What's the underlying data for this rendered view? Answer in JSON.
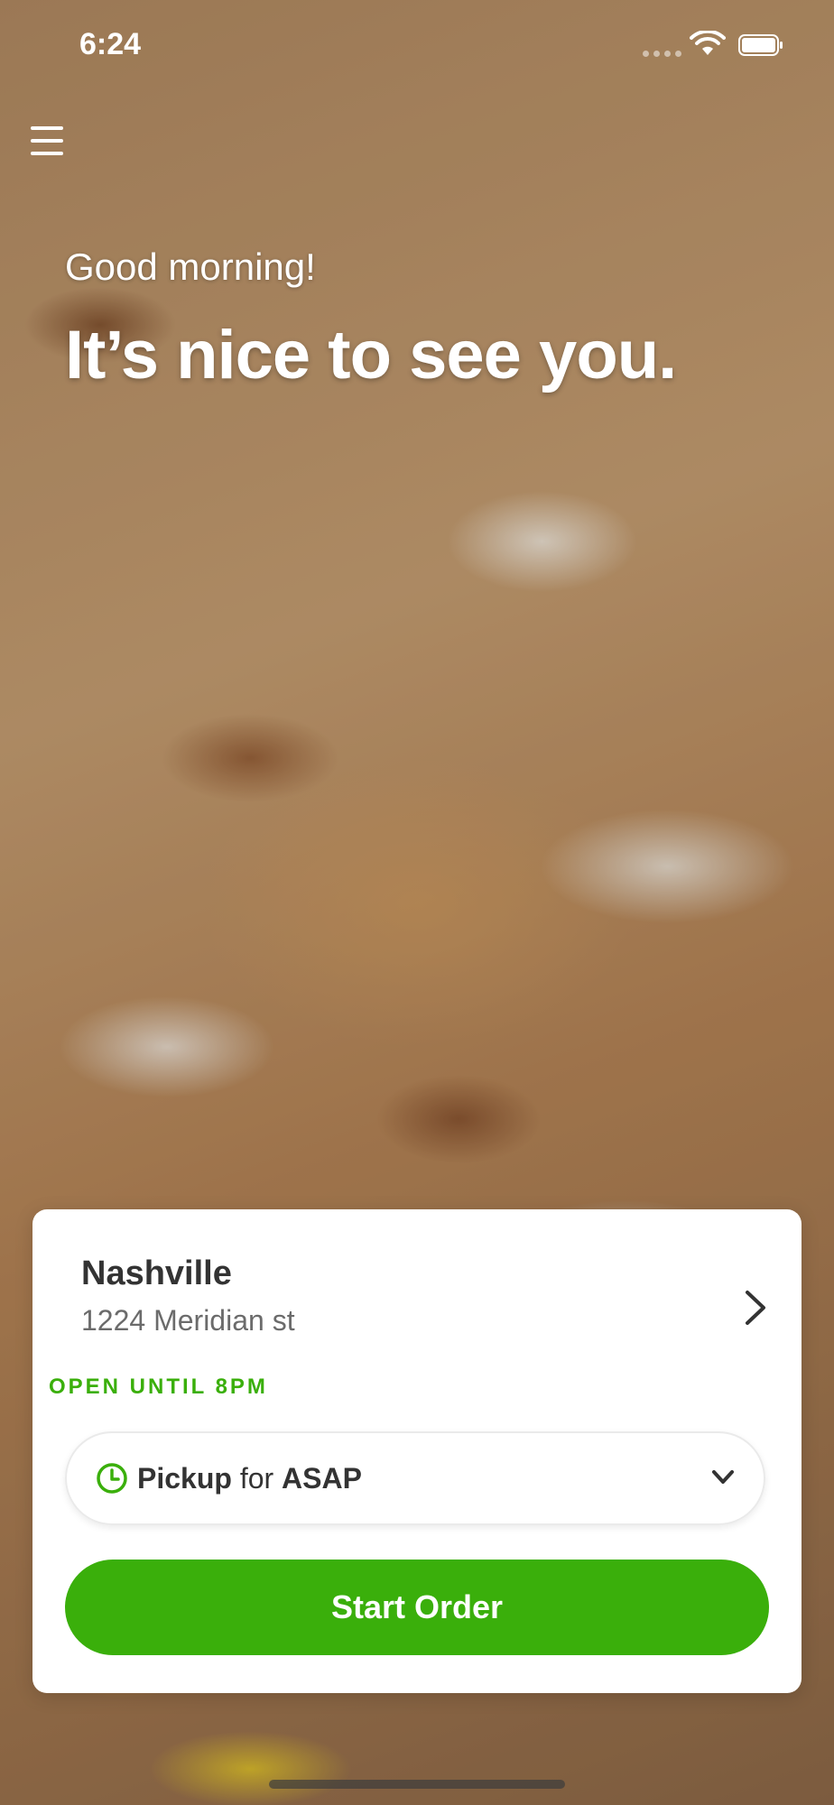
{
  "status_bar": {
    "time": "6:24"
  },
  "greeting": {
    "subtitle": "Good morning!",
    "title": "It’s nice to see you."
  },
  "location": {
    "name": "Nashville",
    "address": "1224 Meridian st",
    "status": "OPEN UNTIL 8PM"
  },
  "order_mode": {
    "method": "Pickup",
    "connector": "for",
    "time": "ASAP"
  },
  "actions": {
    "start_order": "Start Order"
  },
  "colors": {
    "accent": "#3aaf0b"
  },
  "icons": {
    "menu": "hamburger-menu-icon",
    "location_chevron": "chevron-right-icon",
    "clock": "clock-icon",
    "dropdown": "chevron-down-icon"
  }
}
